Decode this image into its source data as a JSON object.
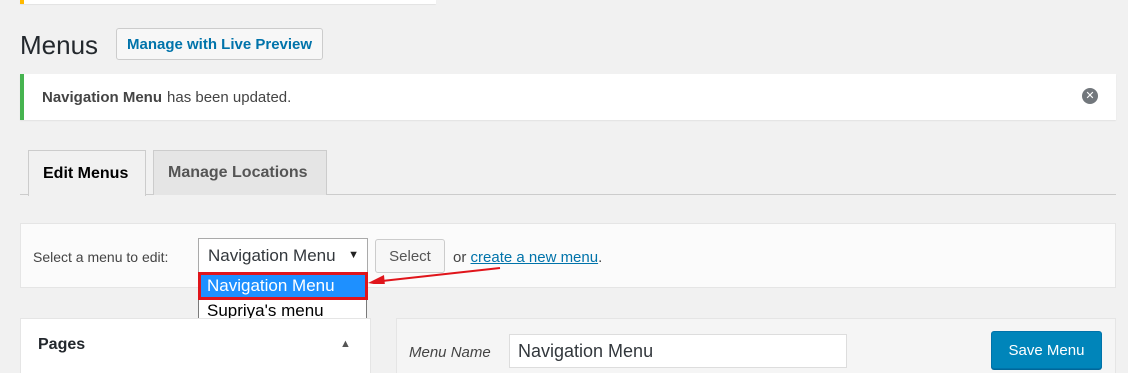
{
  "header": {
    "title": "Menus",
    "live_preview_label": "Manage with Live Preview"
  },
  "notice": {
    "menu_name": "Navigation Menu",
    "message": "has been updated.",
    "dismiss_icon": "close-circle-icon"
  },
  "tabs": [
    {
      "label": "Edit Menus",
      "active": true
    },
    {
      "label": "Manage Locations",
      "active": false
    }
  ],
  "manage": {
    "select_label": "Select a menu to edit:",
    "selected_value": "Navigation Menu",
    "select_button": "Select",
    "or_text": "or",
    "create_link": "create a new menu",
    "period": "."
  },
  "dropdown": {
    "options": [
      "Navigation Menu",
      "Supriya's menu"
    ],
    "selected_index": 0
  },
  "pages_panel": {
    "title": "Pages",
    "collapse_icon": "triangle-up-icon"
  },
  "menu_editor": {
    "name_label": "Menu Name",
    "name_value": "Navigation Menu",
    "save_label": "Save Menu"
  },
  "colors": {
    "notice_success": "#46b450",
    "primary_button": "#0085ba",
    "link": "#0073aa",
    "annotation": "#e0151b",
    "dropdown_selected": "#1e90ff"
  }
}
